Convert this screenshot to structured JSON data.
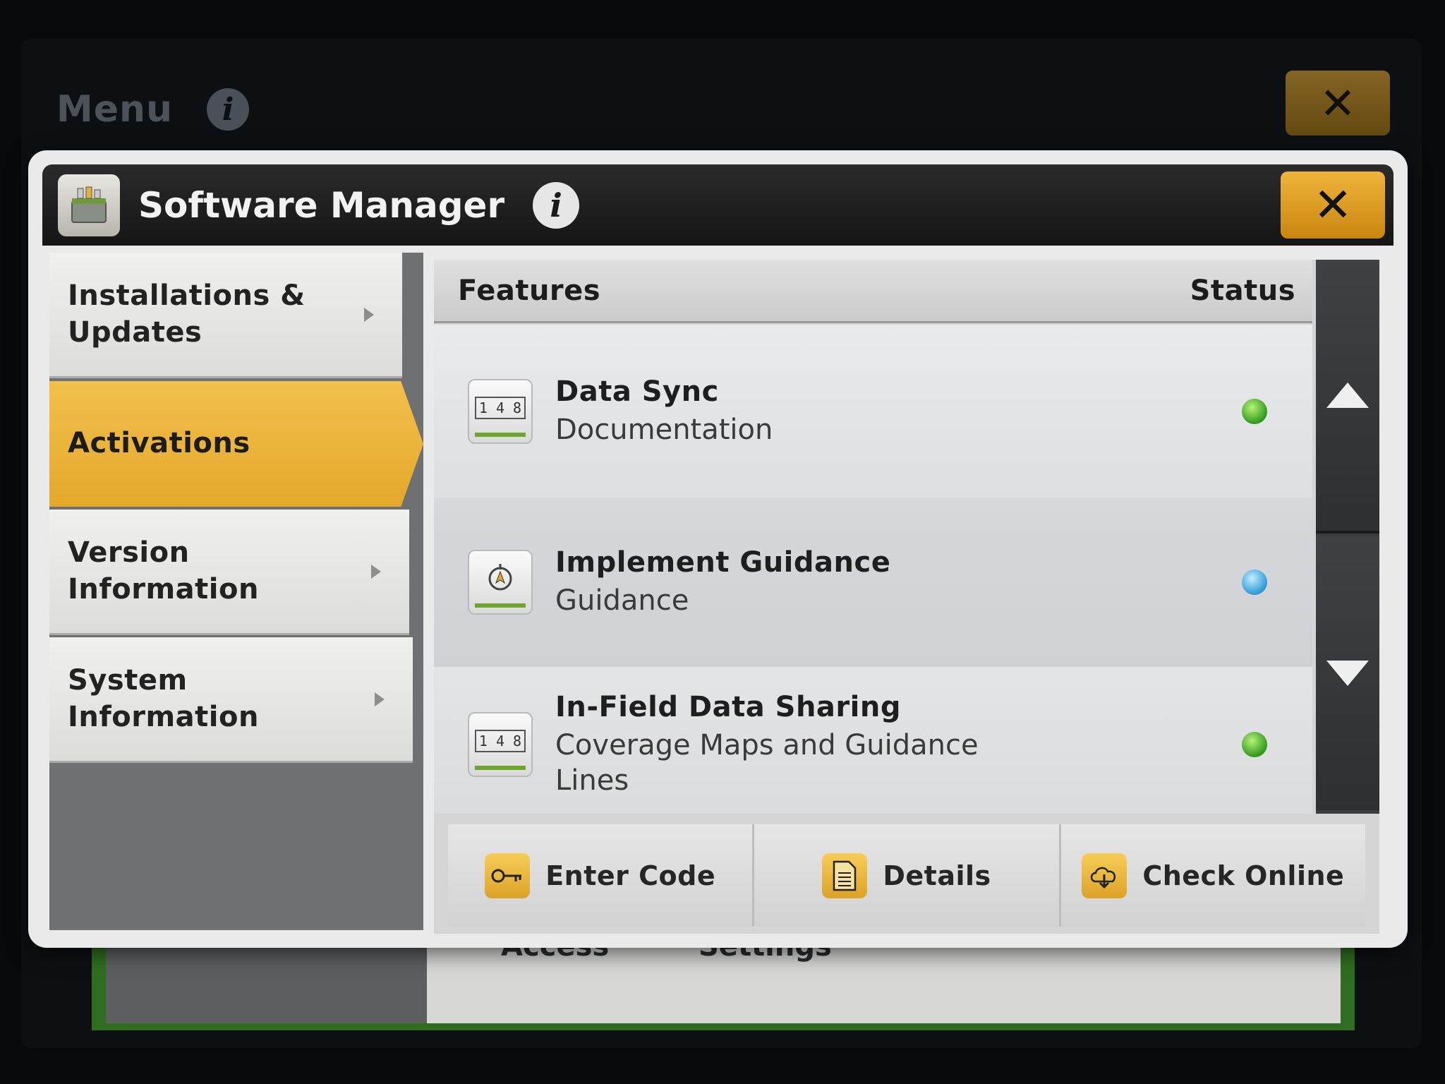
{
  "background_screen": {
    "title": "Menu",
    "info_icon": "info-icon",
    "close_label": "✕",
    "partial_labels": [
      "Access",
      "Settings"
    ]
  },
  "dialog": {
    "title": "Software Manager",
    "info_icon": "info-icon",
    "close_label": "✕"
  },
  "sidebar": {
    "items": [
      {
        "label": "Installations &\nUpdates",
        "active": false
      },
      {
        "label": "Activations",
        "active": true
      },
      {
        "label": "Version\nInformation",
        "active": false
      },
      {
        "label": "System\nInformation",
        "active": false
      }
    ]
  },
  "table": {
    "headers": {
      "features": "Features",
      "status": "Status"
    },
    "rows": [
      {
        "title": "Data Sync",
        "subtitle": "Documentation",
        "icon": "counter-icon",
        "status_color": "#3fae22"
      },
      {
        "title": "Implement Guidance",
        "subtitle": "Guidance",
        "icon": "guidance-icon",
        "status_color": "#2b9bd6"
      },
      {
        "title": "In-Field Data Sharing",
        "subtitle": "Coverage Maps and Guidance Lines",
        "icon": "counter-icon",
        "status_color": "#3fae22"
      }
    ],
    "counter_digits": "1 4 8"
  },
  "actions": {
    "enter_code": "Enter Code",
    "details": "Details",
    "check_online": "Check Online"
  },
  "colors": {
    "accent": "#e8ad2e",
    "header_bg": "#1c1c1c"
  }
}
